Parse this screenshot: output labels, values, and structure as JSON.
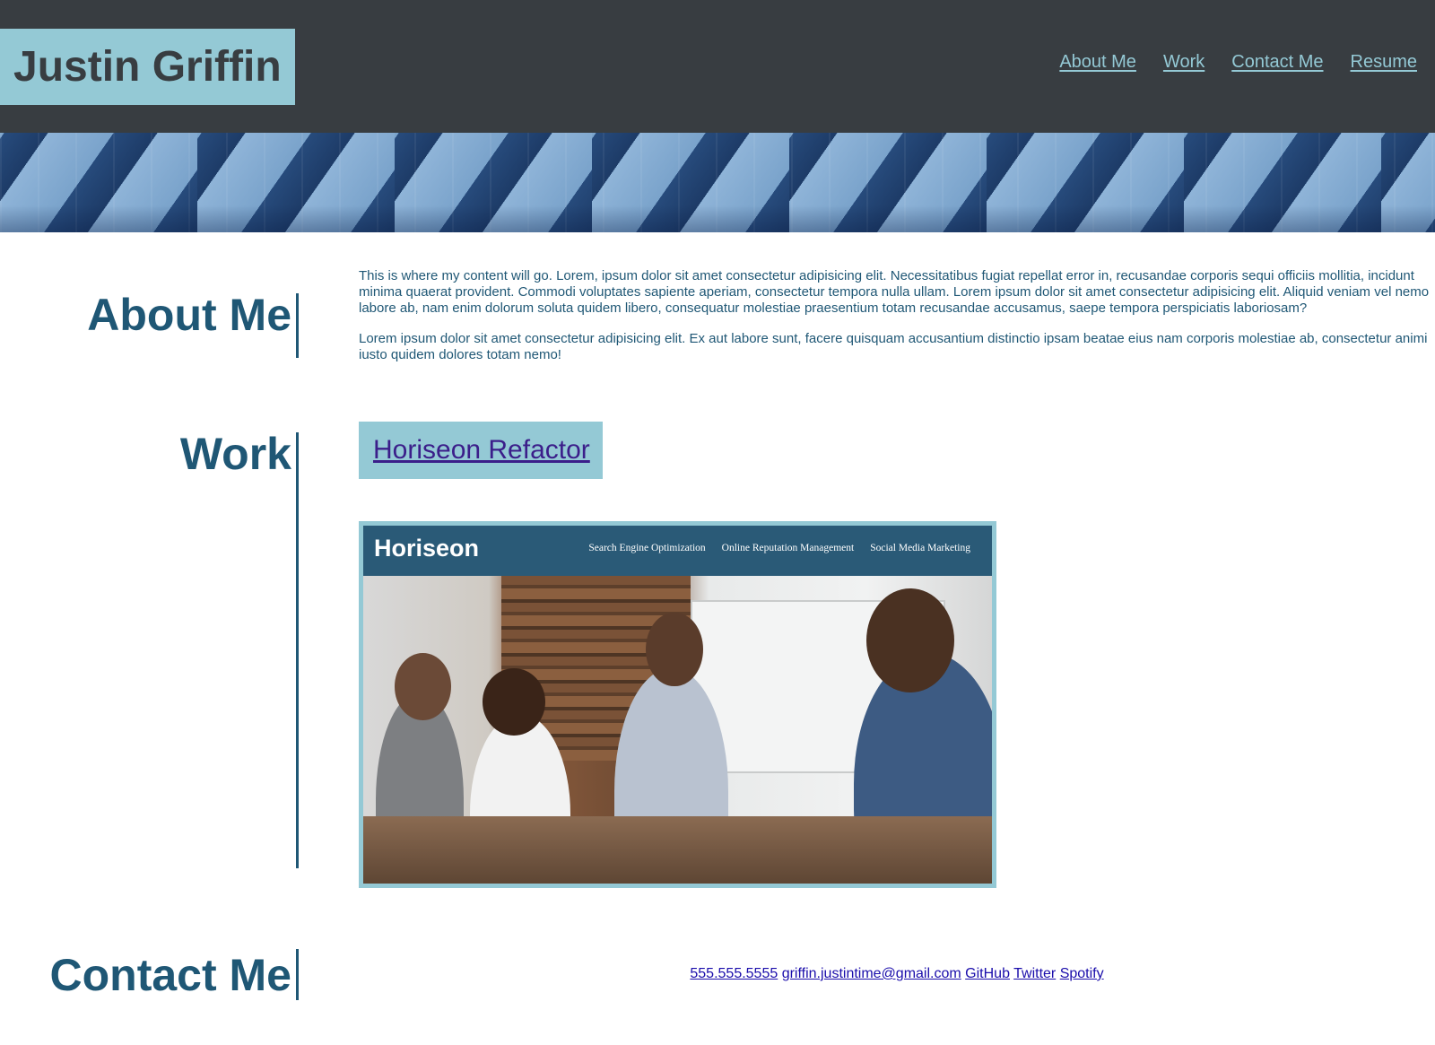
{
  "header": {
    "title": "Justin Griffin",
    "nav": [
      {
        "label": "About Me"
      },
      {
        "label": "Work"
      },
      {
        "label": "Contact Me"
      },
      {
        "label": "Resume"
      }
    ]
  },
  "about": {
    "heading": "About Me",
    "paragraphs": [
      "This is where my content will go. Lorem, ipsum dolor sit amet consectetur adipisicing elit. Necessitatibus fugiat repellat error in, recusandae corporis sequi officiis mollitia, incidunt minima quaerat provident. Commodi voluptates sapiente aperiam, consectetur tempora nulla ullam. Lorem ipsum dolor sit amet consectetur adipisicing elit. Aliquid veniam vel nemo labore ab, nam enim dolorum soluta quidem libero, consequatur molestiae praesentium totam recusandae accusamus, saepe tempora perspiciatis laboriosam?",
      "Lorem ipsum dolor sit amet consectetur adipisicing elit. Ex aut labore sunt, facere quisquam accusantium distinctio ipsam beatae eius nam corporis molestiae ab, consectetur animi iusto quidem dolores totam nemo!"
    ]
  },
  "work": {
    "heading": "Work",
    "project_title": "Horiseon Refactor",
    "screenshot": {
      "brand": "Horiseon",
      "nav": [
        "Search Engine Optimization",
        "Online Reputation Management",
        "Social Media Marketing"
      ]
    }
  },
  "contact": {
    "heading": "Contact Me",
    "links": [
      {
        "label": "555.555.5555"
      },
      {
        "label": "griffin.justintime@gmail.com"
      },
      {
        "label": "GitHub"
      },
      {
        "label": "Twitter"
      },
      {
        "label": "Spotify"
      }
    ]
  },
  "colors": {
    "header_bg": "#383d41",
    "accent": "#94c9d5",
    "heading": "#1f5775",
    "link": "#1a0dab"
  }
}
